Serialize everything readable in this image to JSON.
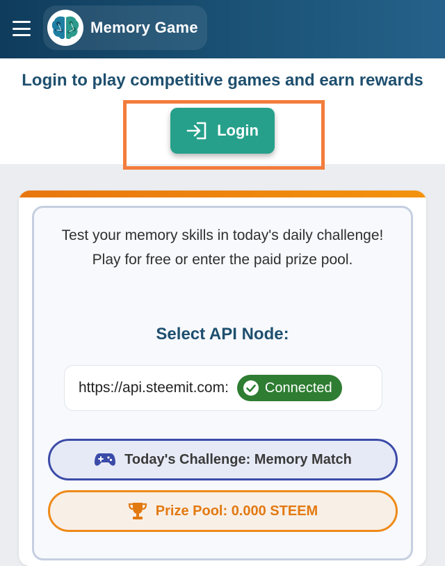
{
  "header": {
    "title": "Memory Game",
    "menu_icon": "hamburger-menu-icon",
    "logo_icon": "brain-logo-icon"
  },
  "login": {
    "prompt": "Login to play competitive games and earn rewards",
    "button_label": "Login",
    "button_icon": "login-arrow-icon",
    "highlight_color": "#f47c3c"
  },
  "card": {
    "intro": "Test your memory skills in today's daily challenge! Play for free or enter the paid prize pool.",
    "api_title": "Select API Node:",
    "node": {
      "url": "https://api.steemit.com:",
      "status": "Connected",
      "status_color": "#2e7d32"
    },
    "challenge": {
      "label": "Today's Challenge: Memory Match",
      "icon": "gamepad-icon"
    },
    "prize": {
      "label": "Prize Pool: 0.000 STEEM",
      "icon": "trophy-icon"
    }
  },
  "colors": {
    "header_bg": "#1c5478",
    "accent_teal": "#26a08b",
    "heading_blue": "#1e4f6e",
    "orange": "#ee8a18",
    "indigo": "#3b4ba8"
  }
}
